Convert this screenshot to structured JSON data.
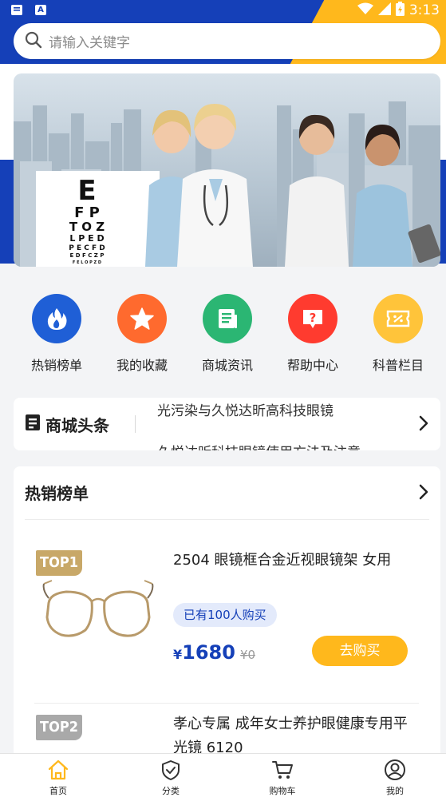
{
  "status_bar": {
    "time": "3:13",
    "left_icons": [
      "message-icon",
      "a-icon"
    ],
    "right_icons": [
      "wifi-icon",
      "signal-icon",
      "battery-icon"
    ]
  },
  "search": {
    "placeholder": "请输入关键字",
    "icon": "search-icon"
  },
  "colors": {
    "primary_blue": "#1540b8",
    "accent_yellow": "#ffb81c",
    "hot_red": "#ff5b2e",
    "news_green": "#2bb673",
    "help_red": "#ff3b2f",
    "tag_gold": "#c8a868",
    "tag_gray": "#a9a9a9"
  },
  "banner": {
    "eye_chart_rows": [
      "E",
      "F P",
      "T O Z",
      "L P E D",
      "P E C F D",
      "E D F C Z P",
      "F E L O P Z D"
    ]
  },
  "quick_menu": [
    {
      "label": "热销榜单",
      "icon": "fire-icon",
      "color": "#1f5fd6"
    },
    {
      "label": "我的收藏",
      "icon": "star-icon",
      "color": "#ff6a2e"
    },
    {
      "label": "商城资讯",
      "icon": "news-icon",
      "color": "#2bb673"
    },
    {
      "label": "帮助中心",
      "icon": "question-icon",
      "color": "#ff3b2f"
    },
    {
      "label": "科普栏目",
      "icon": "ticket-icon",
      "color": "#ffc43a"
    }
  ],
  "headline": {
    "title": "商城头条",
    "items": [
      "光污染与久悦达昕高科技眼镜",
      "久悦达昕科技眼镜使用方法及注意"
    ]
  },
  "hot_list": {
    "title": "热销榜单",
    "products": [
      {
        "rank": "TOP1",
        "name": "2504 眼镜框合金近视眼镜架 女用",
        "sold": "已有100人购买",
        "currency": "¥",
        "price": "1680",
        "old_price": "¥0",
        "buy": "去购买"
      },
      {
        "rank": "TOP2",
        "name": "孝心专属 成年女士养护眼健康专用平光镜 6120"
      }
    ]
  },
  "bottom_nav": [
    {
      "label": "首页",
      "icon": "home-icon",
      "active": true
    },
    {
      "label": "分类",
      "icon": "category-icon",
      "active": false
    },
    {
      "label": "购物车",
      "icon": "cart-icon",
      "active": false
    },
    {
      "label": "我的",
      "icon": "profile-icon",
      "active": false
    }
  ]
}
